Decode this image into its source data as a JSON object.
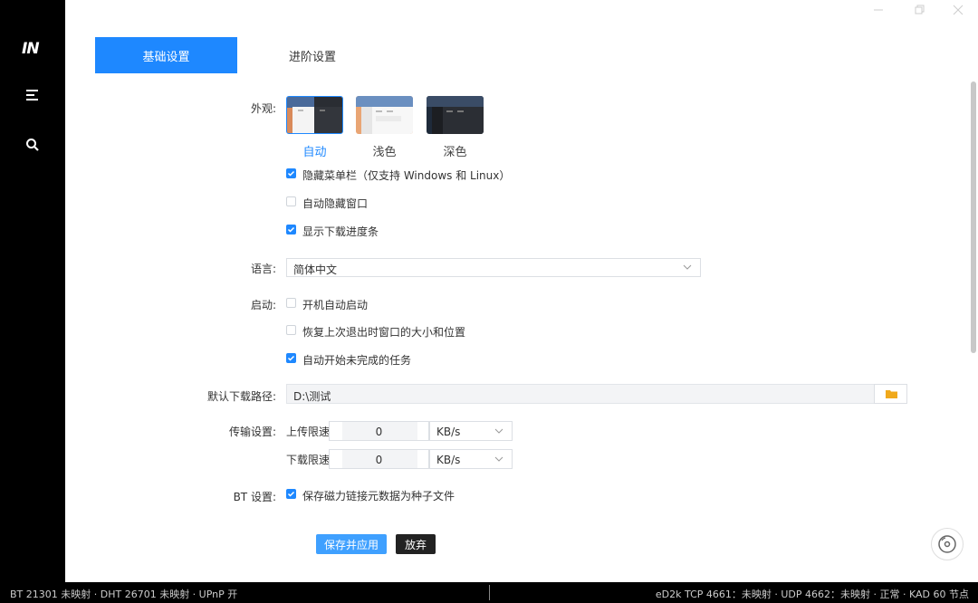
{
  "sidebar": {
    "logo": "IN",
    "icons": [
      "menu-icon",
      "search-icon"
    ]
  },
  "window_controls": [
    "minimize-icon",
    "maximize-icon",
    "close-icon"
  ],
  "tabs": [
    {
      "label": "基础设置",
      "active": true
    },
    {
      "label": "进阶设置",
      "active": false
    }
  ],
  "appearance": {
    "label": "外观:",
    "options": [
      {
        "label": "自动",
        "selected": true
      },
      {
        "label": "浅色",
        "selected": false
      },
      {
        "label": "深色",
        "selected": false
      }
    ],
    "checkboxes": [
      {
        "label": "隐藏菜单栏（仅支持 Windows 和 Linux）",
        "checked": true
      },
      {
        "label": "自动隐藏窗口",
        "checked": false
      },
      {
        "label": "显示下载进度条",
        "checked": true
      }
    ]
  },
  "language": {
    "label": "语言:",
    "value": "简体中文"
  },
  "startup": {
    "label": "启动:",
    "checkboxes": [
      {
        "label": "开机自动启动",
        "checked": false
      },
      {
        "label": "恢复上次退出时窗口的大小和位置",
        "checked": false
      },
      {
        "label": "自动开始未完成的任务",
        "checked": true
      }
    ]
  },
  "download_path": {
    "label": "默认下载路径:",
    "value": "D:\\测试"
  },
  "transfer": {
    "label": "传输设置:",
    "upload": {
      "label": "上传限速",
      "value": "0",
      "unit": "KB/s"
    },
    "download": {
      "label": "下载限速",
      "value": "0",
      "unit": "KB/s"
    }
  },
  "bt": {
    "label": "BT 设置:",
    "checkbox": {
      "label": "保存磁力链接元数据为种子文件",
      "checked": true
    }
  },
  "buttons": {
    "save": "保存并应用",
    "discard": "放弃"
  },
  "statusbar": {
    "left": "BT 21301 未映射 · DHT 26701 未映射 · UPnP 开",
    "right": "eD2k TCP 4661：未映射 · UDP 4662：未映射 · 正常 · KAD 60 节点"
  },
  "colors": {
    "accent": "#1e88ff",
    "sidebar": "#000000",
    "statusbar": "#000000"
  }
}
